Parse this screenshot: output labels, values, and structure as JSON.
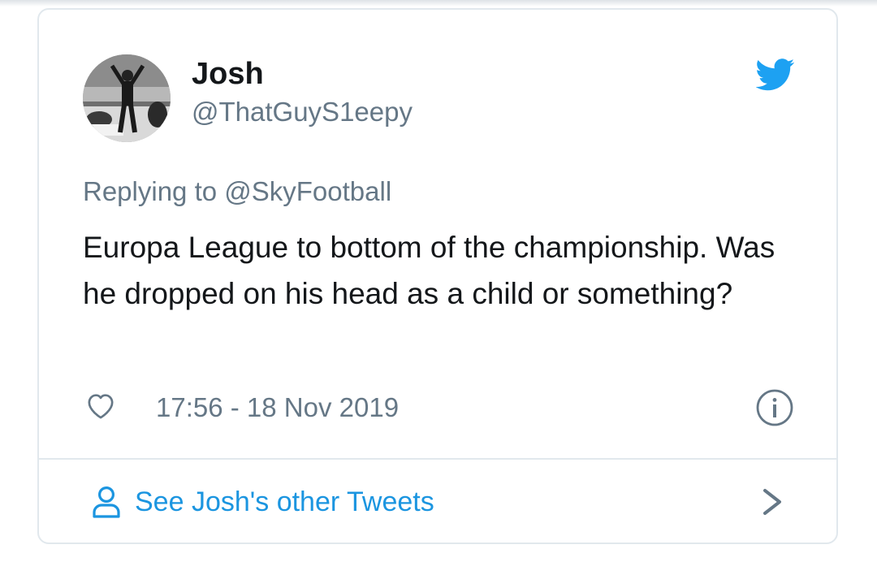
{
  "tweet": {
    "author_name": "Josh",
    "author_handle": "@ThatGuyS1eepy",
    "replying_to": "Replying to @SkyFootball",
    "text": "Europa League to bottom of the championship. Was he dropped on his head as a child or something?",
    "timestamp": "17:56 - 18 Nov 2019"
  },
  "footer": {
    "see_other_label": "See Josh's other Tweets"
  },
  "icons": {
    "brand": "twitter-bird-icon",
    "like": "heart-icon",
    "info": "info-icon",
    "profile": "person-icon",
    "next": "chevron-right-icon"
  },
  "colors": {
    "twitter_blue": "#1da1f2",
    "link_blue": "#1b95e0",
    "text_primary": "#14171a",
    "text_secondary": "#657786",
    "border": "#e1e8ed"
  }
}
